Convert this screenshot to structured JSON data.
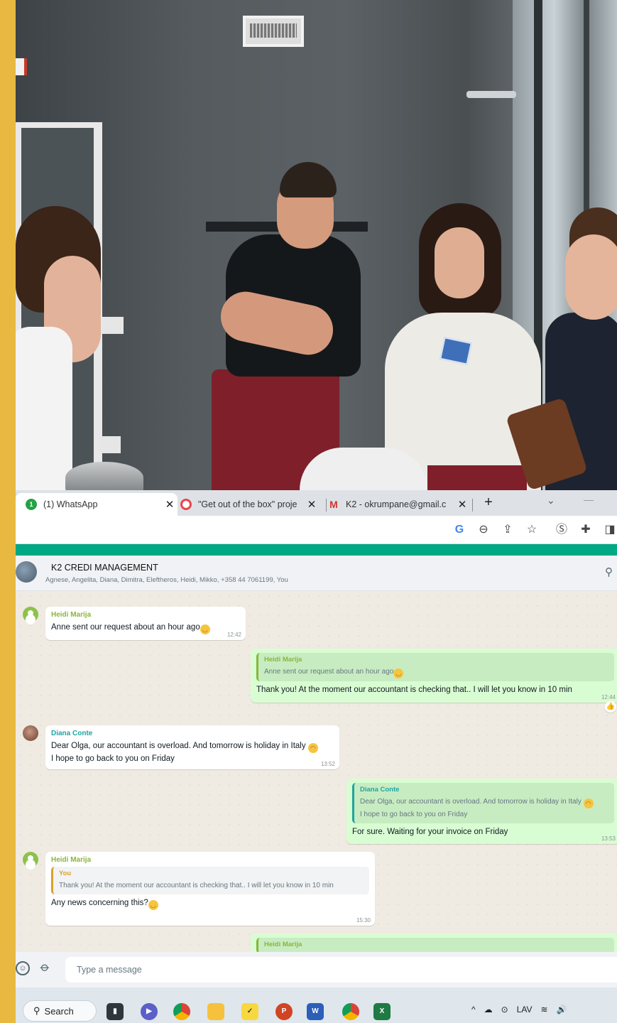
{
  "browser": {
    "tabs": [
      {
        "label": "(1) WhatsApp",
        "icon": "whatsapp-icon",
        "active": true
      },
      {
        "label": "\"Get out of the box\" proje",
        "icon": "target-icon",
        "active": false
      },
      {
        "label": "K2 - okrumpane@gmail.c",
        "icon": "gmail-icon",
        "active": false
      }
    ],
    "close_glyph": "✕",
    "new_tab_glyph": "+",
    "google_glyph": "G"
  },
  "whatsapp": {
    "accent_color": "#00a884",
    "group_name": "K2 CREDI MANAGEMENT",
    "group_members": "Agnese, Angelita, Diana, Dimitra, Eleftheros, Heidi, Mikko, +358 44 7061199, You",
    "messages": [
      {
        "sender": "Heidi Marija",
        "text": "Anne sent our request about an hour ago",
        "time": "12:42"
      },
      {
        "quote_sender": "Heidi Marija",
        "quote_text": "Anne sent our request about an hour ago",
        "text": "Thank you! At the moment our accountant is checking that.. I will let you know in 10 min",
        "time": "12:44"
      },
      {
        "sender": "Diana Conte",
        "line1": "Dear Olga, our accountant is overload. And tomorrow is holiday in Italy",
        "line2": "I hope to go back to you on Friday",
        "time": "13:52"
      },
      {
        "quote_sender": "Diana Conte",
        "quote_line1": "Dear Olga, our accountant is overload. And tomorrow is holiday in Italy",
        "quote_line2": "I hope to go back to you on Friday",
        "text": "For sure. Waiting for your invoice on Friday",
        "time": "13:53"
      },
      {
        "sender": "Heidi Marija",
        "quote_sender": "You",
        "quote_text": "Thank you! At the moment our accountant is checking that.. I will let you know in 10 min",
        "text": "Any news concerning this?",
        "time": "15:30"
      },
      {
        "quote_sender": "Heidi Marija"
      }
    ],
    "input_placeholder": "Type a message"
  },
  "taskbar": {
    "search_label": "Search",
    "language": "LAV",
    "apps": [
      "task-view-icon",
      "teams-icon",
      "chrome-icon",
      "file-explorer-icon",
      "todo-icon",
      "powerpoint-icon",
      "word-icon",
      "chrome-icon",
      "excel-icon"
    ]
  }
}
